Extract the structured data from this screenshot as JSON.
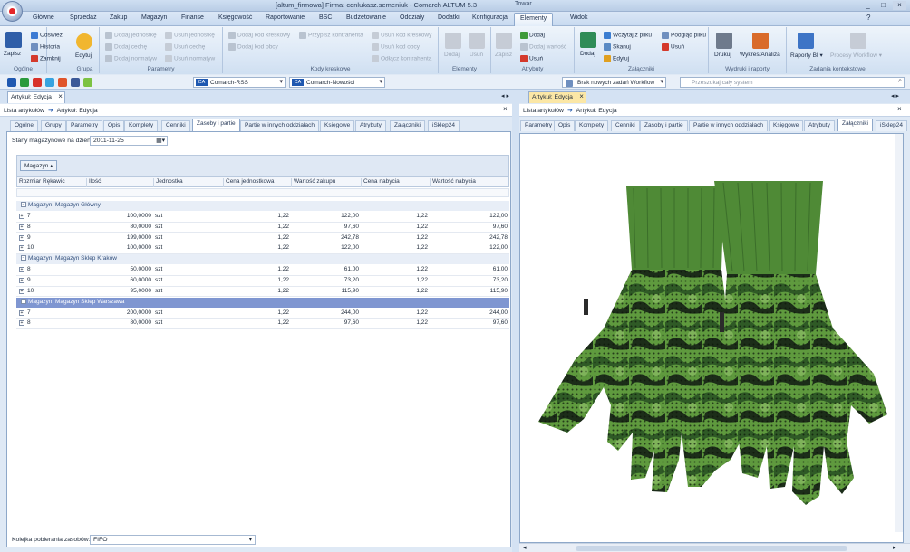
{
  "window": {
    "title": "[altum_firmowa] Firma: cdnlukasz.semeniuk - Comarch ALTUM 5.3",
    "context_label": "Towar",
    "buttons": [
      "_",
      "□",
      "×"
    ]
  },
  "ribbon_tabs": [
    "Główne",
    "Sprzedaż",
    "Zakup",
    "Magazyn",
    "Finanse",
    "Księgowość",
    "Raportowanie",
    "BSC",
    "Budżetowanie",
    "Oddziały",
    "Dodatki",
    "Konfiguracja",
    "Elementy",
    "Widok"
  ],
  "active_tab": "Elementy",
  "ribbon": {
    "ogolne": {
      "label": "Ogólne",
      "zapisz": "Zapisz",
      "odswiez": "Odśwież",
      "historia": "Historia",
      "zamknij": "Zamknij"
    },
    "grupa": {
      "label": "Grupa",
      "edytuj": "Edytuj"
    },
    "parametry": {
      "label": "Parametry",
      "items": [
        "Dodaj jednostkę",
        "Dodaj cechę",
        "Dodaj normatyw",
        "Usuń jednostkę",
        "Usuń cechę",
        "Usuń normatyw"
      ]
    },
    "kody": {
      "label": "Kody kreskowe",
      "items": [
        "Dodaj kod kreskowy",
        "Dodaj kod obcy",
        "Przypisz kontrahenta",
        "Usuń kod kreskowy",
        "Usuń kod obcy",
        "Odłącz kontrahenta"
      ]
    },
    "elementy": {
      "label": "Elementy",
      "dodaj": "Dodaj",
      "usun": "Usuń"
    },
    "atrybuty": {
      "label": "Atrybuty",
      "zapisz": "Zapisz",
      "dodaj": "Dodaj",
      "dodaj_wartosc": "Dodaj wartość",
      "usun": "Usuń"
    },
    "zalaczniki": {
      "label": "Załączniki",
      "dodaj": "Dodaj",
      "wczytaj": "Wczytaj z pliku",
      "skanuj": "Skanuj",
      "edytuj": "Edytuj",
      "podglad": "Podgląd pliku",
      "usun": "Usuń"
    },
    "wydruki": {
      "label": "Wydruki i raporty",
      "drukuj": "Drukuj",
      "wykres": "Wykres/Analiza"
    },
    "zadania": {
      "label": "Zadania kontekstowe",
      "raporty": "Raporty BI ▾",
      "procesy": "Procesy Workflow ▾"
    }
  },
  "quickbar": {
    "combo1": "Comarch-RSS",
    "combo2": "Comarch-Nowości",
    "workflow": "Brak nowych zadań Workflow",
    "search_placeholder": "Przeszukaj cały system",
    "ca": "CA"
  },
  "left": {
    "doc_tab": "Artykuł: Edycja",
    "crumb_list": "Lista artykułów",
    "crumb_current": "Artykuł: Edycja",
    "tabs": [
      "Ogólne",
      "Grupy",
      "Parametry",
      "Opis",
      "Komplety",
      "Cenniki",
      "Zasoby i partie",
      "Partie w innych oddziałach",
      "Księgowe",
      "Atrybuty",
      "Załączniki",
      "iSklep24"
    ],
    "active_tab": "Zasoby i partie",
    "date_label": "Stany magazynowe na dzień:",
    "date_value": "2011-11-25",
    "group_chip": "Magazyn",
    "columns": [
      "Rozmiar Rękawic",
      "Ilość",
      "Jednostka",
      "Cena jednostkowa",
      "Wartość zakupu",
      "Cena nabycia",
      "Wartość nabycia"
    ],
    "groups": [
      {
        "label": "Magazyn: Magazyn Główny",
        "rows": [
          {
            "size": "7",
            "qty": "100,0000",
            "unit": "szt",
            "price": "1,22",
            "value": "122,00",
            "cost": "1,22",
            "costval": "122,00"
          },
          {
            "size": "8",
            "qty": "80,0000",
            "unit": "szt",
            "price": "1,22",
            "value": "97,60",
            "cost": "1,22",
            "costval": "97,60"
          },
          {
            "size": "9",
            "qty": "199,0000",
            "unit": "szt",
            "price": "1,22",
            "value": "242,78",
            "cost": "1,22",
            "costval": "242,78"
          },
          {
            "size": "10",
            "qty": "100,0000",
            "unit": "szt",
            "price": "1,22",
            "value": "122,00",
            "cost": "1,22",
            "costval": "122,00"
          }
        ]
      },
      {
        "label": "Magazyn: Magazyn Sklep Kraków",
        "rows": [
          {
            "size": "8",
            "qty": "50,0000",
            "unit": "szt",
            "price": "1,22",
            "value": "61,00",
            "cost": "1,22",
            "costval": "61,00"
          },
          {
            "size": "9",
            "qty": "60,0000",
            "unit": "szt",
            "price": "1,22",
            "value": "73,20",
            "cost": "1,22",
            "costval": "73,20"
          },
          {
            "size": "10",
            "qty": "95,0000",
            "unit": "szt",
            "price": "1,22",
            "value": "115,90",
            "cost": "1,22",
            "costval": "115,90"
          }
        ]
      },
      {
        "label": "Magazyn: Magazyn Sklep Warszawa",
        "rows": [
          {
            "size": "7",
            "qty": "200,0000",
            "unit": "szt",
            "price": "1,22",
            "value": "244,00",
            "cost": "1,22",
            "costval": "244,00"
          },
          {
            "size": "8",
            "qty": "80,0000",
            "unit": "szt",
            "price": "1,22",
            "value": "97,60",
            "cost": "1,22",
            "costval": "97,60"
          }
        ]
      }
    ],
    "queue_label": "Kolejka pobierania zasobów:",
    "queue_value": "FIFO"
  },
  "right": {
    "doc_tab": "Artykuł: Edycja",
    "crumb_list": "Lista artykułów",
    "crumb_current": "Artykuł: Edycja",
    "tabs": [
      "Parametry",
      "Opis",
      "Komplety",
      "Cenniki",
      "Zasoby i partie",
      "Partie w innych oddziałach",
      "Księgowe",
      "Atrybuty",
      "Załączniki",
      "iSklep24"
    ],
    "active_tab": "Załączniki"
  },
  "colors": {
    "accent": "#2f62b3",
    "selected_group": "#7f96d1",
    "glove_green": "#3e7a35"
  }
}
